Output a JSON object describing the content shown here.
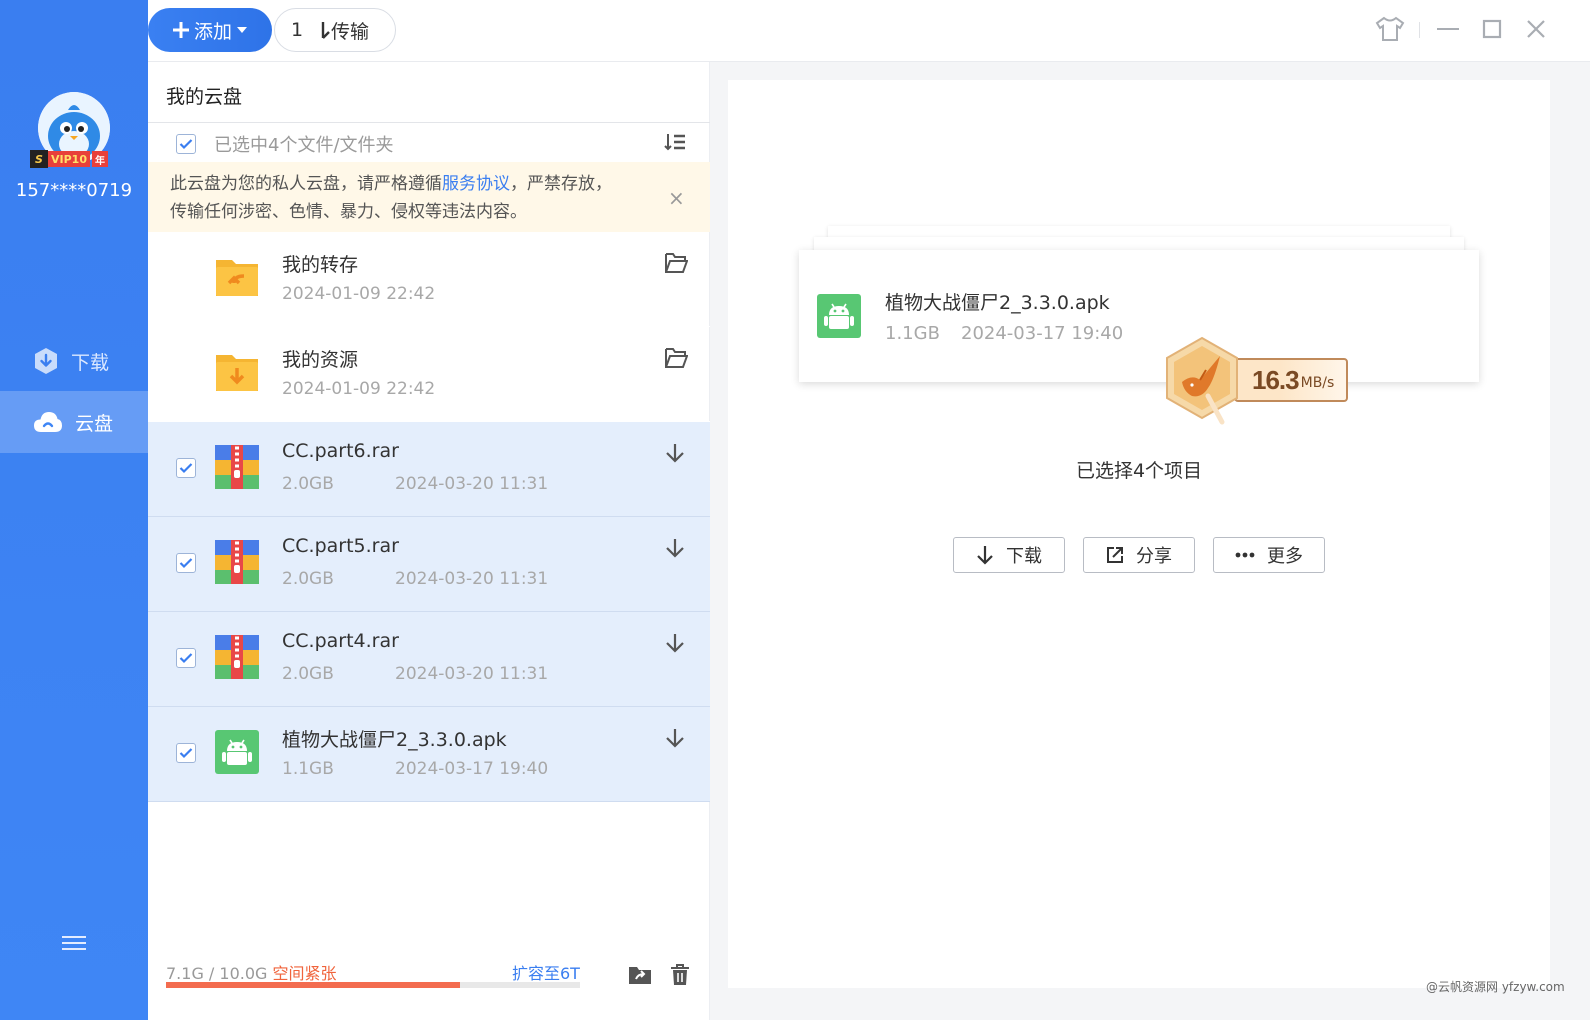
{
  "sidebar": {
    "vip_badge": {
      "s": "S",
      "vip": "VIP10",
      "year": "年"
    },
    "username": "157****0719",
    "nav": [
      {
        "label": "下载",
        "icon": "download-shield-icon"
      },
      {
        "label": "云盘",
        "icon": "cloud-icon"
      }
    ]
  },
  "topbar": {
    "add_label": "添加",
    "transfer_count": "1",
    "transfer_label": "传输"
  },
  "list": {
    "breadcrumb": "我的云盘",
    "selection_text": "已选中4个文件/文件夹",
    "notice": {
      "text_before": "此云盘为您的私人云盘，请严格遵循",
      "link": "服务协议",
      "text_after": "，严禁存放，",
      "line2": "传输任何涉密、色情、暴力、侵权等违法内容。",
      "close": "×"
    },
    "rows": [
      {
        "name": "我的转存",
        "size": "",
        "date": "2024-01-09 22:42",
        "type": "folder-transfer",
        "selected": false
      },
      {
        "name": "我的资源",
        "size": "",
        "date": "2024-01-09 22:42",
        "type": "folder-resource",
        "selected": false
      },
      {
        "name": "CC.part6.rar",
        "size": "2.0GB",
        "date": "2024-03-20 11:31",
        "type": "rar",
        "selected": true
      },
      {
        "name": "CC.part5.rar",
        "size": "2.0GB",
        "date": "2024-03-20 11:31",
        "type": "rar",
        "selected": true
      },
      {
        "name": "CC.part4.rar",
        "size": "2.0GB",
        "date": "2024-03-20 11:31",
        "type": "rar",
        "selected": true
      },
      {
        "name": "植物大战僵尸2_3.3.0.apk",
        "size": "1.1GB",
        "date": "2024-03-17 19:40",
        "type": "apk",
        "selected": true
      }
    ],
    "storage": {
      "used": "7.1G / 10.0G",
      "warning": "空间紧张",
      "expand": "扩容至6T",
      "used_fraction": 0.71
    }
  },
  "preview": {
    "file_name": "植物大战僵尸2_3.3.0.apk",
    "file_size": "1.1GB",
    "file_date": "2024-03-17 19:40",
    "speed_value": "16.3",
    "speed_unit": "MB/s",
    "selection_summary": "已选择4个项目",
    "actions": [
      {
        "label": "下载",
        "icon": "download-arrow-icon"
      },
      {
        "label": "分享",
        "icon": "share-external-icon"
      },
      {
        "label": "更多",
        "icon": "more-dots-icon"
      }
    ]
  },
  "watermark": "@云帆资源网 yfzyw.com",
  "colors": {
    "brand_blue": "#3a7ef0",
    "selected_row": "#e4eefc",
    "notice_bg": "#fff8e8",
    "warning": "#f0643c"
  }
}
